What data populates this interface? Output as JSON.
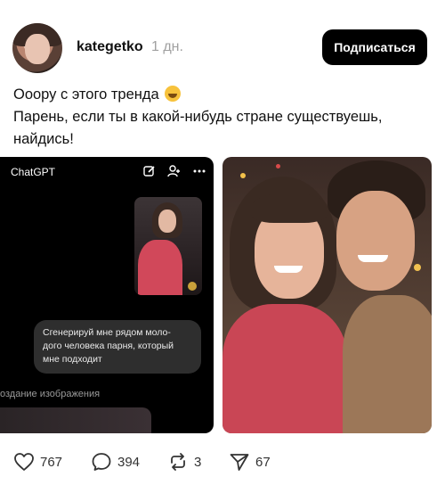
{
  "header": {
    "username": "kategetko",
    "time": "1 дн.",
    "follow_label": "Подписаться"
  },
  "post": {
    "line1": "Ооору с этого тренда",
    "line2": "Парень, если ты в какой-нибудь стране существуешь,",
    "line3": "найдись!",
    "emoji": "grinning-sweat-emoji"
  },
  "chat_screenshot": {
    "app_title": "ChatGPT",
    "icons": [
      "edit-icon",
      "add-person-icon",
      "more-icon"
    ],
    "prompt_line1": "Сгенерируй мне рядом моло-",
    "prompt_line2": "дого человека парня, который",
    "prompt_line3": "мне подходит",
    "status": "оздание изображения"
  },
  "actions": {
    "likes": "767",
    "comments": "394",
    "reposts": "3",
    "shares": "67"
  },
  "colors": {
    "follow_bg": "#000000",
    "follow_text": "#ffffff",
    "muted": "#a0a0a0"
  }
}
